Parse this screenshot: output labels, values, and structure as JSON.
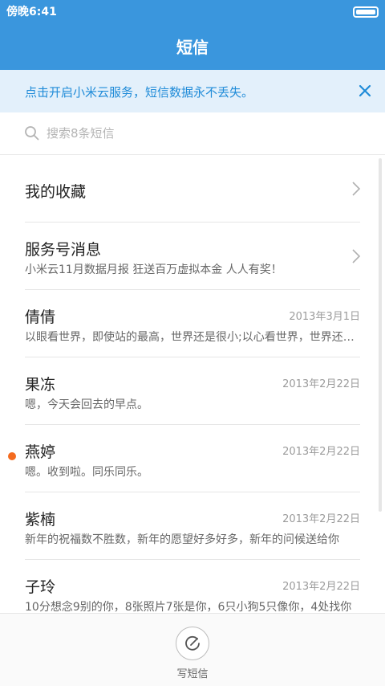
{
  "statusbar": {
    "time": "傍晚6:41"
  },
  "header": {
    "title": "短信"
  },
  "banner": {
    "text": "点击开启小米云服务，短信数据永不丢失。"
  },
  "search": {
    "placeholder": "搜索8条短信"
  },
  "favorites": {
    "label": "我的收藏"
  },
  "service": {
    "title": "服务号消息",
    "preview": "小米云11月数据月报 狂送百万虚拟本金 人人有奖！"
  },
  "conversations": [
    {
      "name": "倩倩",
      "date": "2013年3月1日",
      "preview": "以眼看世界，即使站的最高，世界还是很小;以心看世界，世界还是很大",
      "unread": false
    },
    {
      "name": "果冻",
      "date": "2013年2月22日",
      "preview": "嗯，今天会回去的早点。",
      "unread": false
    },
    {
      "name": "燕婷",
      "date": "2013年2月22日",
      "preview": "嗯。收到啦。同乐同乐。",
      "unread": true
    },
    {
      "name": "紫楠",
      "date": "2013年2月22日",
      "preview": "新年的祝福数不胜数，新年的愿望好多好多，新年的问候送给你",
      "unread": false
    },
    {
      "name": "子玲",
      "date": "2013年2月22日",
      "preview": "10分想念9别的你，8张照片7张是你，6只小狗5只像你，4处找你",
      "unread": false
    }
  ],
  "compose": {
    "label": "写短信"
  },
  "colors": {
    "primary": "#3a96dd",
    "banner_bg": "#e3f0fb",
    "banner_text": "#1f8bd8",
    "unread_dot": "#f46b1f"
  },
  "icons": {
    "search": "search-icon",
    "close": "close-icon",
    "chevron": "chevron-right-icon",
    "compose": "compose-icon"
  }
}
